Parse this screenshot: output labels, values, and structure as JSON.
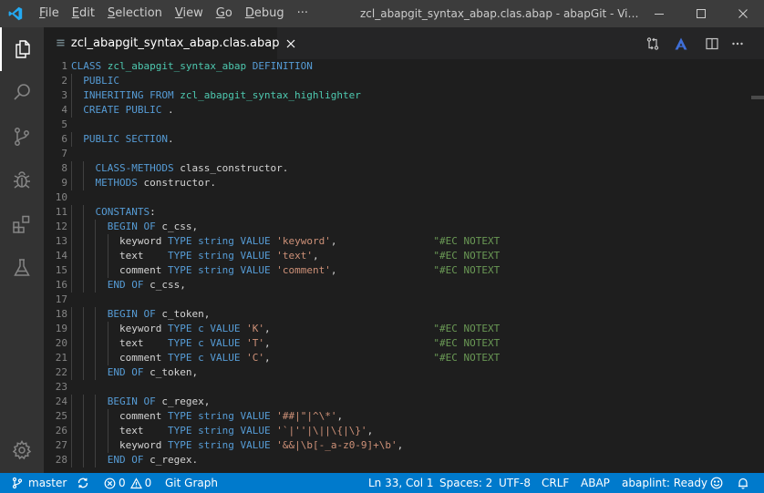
{
  "titlebar": {
    "menu": [
      "File",
      "Edit",
      "Selection",
      "View",
      "Go",
      "Debug",
      "···"
    ],
    "menu_accel": [
      0,
      0,
      0,
      0,
      0,
      0,
      -1
    ],
    "title": "zcl_abapgit_syntax_abap.clas.abap - abapGit - Visual Studio Code"
  },
  "tab": {
    "label": "zcl_abapgit_syntax_abap.clas.abap"
  },
  "editor": {
    "line_numbers": [
      "1",
      "2",
      "3",
      "4",
      "5",
      "6",
      "7",
      "8",
      "9",
      "10",
      "11",
      "12",
      "13",
      "14",
      "15",
      "16",
      "17",
      "18",
      "19",
      "20",
      "21",
      "22",
      "23",
      "24",
      "25",
      "26",
      "27",
      "28"
    ],
    "lines": [
      [
        [
          "kw",
          "CLASS "
        ],
        [
          "cls",
          "zcl_abapgit_syntax_abap"
        ],
        [
          "kw",
          " DEFINITION"
        ]
      ],
      [
        [
          "p",
          "  "
        ],
        [
          "kw",
          "PUBLIC"
        ]
      ],
      [
        [
          "p",
          "  "
        ],
        [
          "kw",
          "INHERITING FROM "
        ],
        [
          "cls",
          "zcl_abapgit_syntax_highlighter"
        ]
      ],
      [
        [
          "p",
          "  "
        ],
        [
          "kw",
          "CREATE PUBLIC"
        ],
        [
          "p",
          " ."
        ]
      ],
      [],
      [
        [
          "p",
          "  "
        ],
        [
          "kw",
          "PUBLIC SECTION"
        ],
        [
          "p",
          "."
        ]
      ],
      [],
      [
        [
          "p",
          "    "
        ],
        [
          "kw",
          "CLASS-METHODS"
        ],
        [
          "p",
          " class_constructor."
        ]
      ],
      [
        [
          "p",
          "    "
        ],
        [
          "kw",
          "METHODS"
        ],
        [
          "p",
          " constructor."
        ]
      ],
      [],
      [
        [
          "p",
          "    "
        ],
        [
          "kw",
          "CONSTANTS"
        ],
        [
          "p",
          ":"
        ]
      ],
      [
        [
          "p",
          "      "
        ],
        [
          "kw",
          "BEGIN OF"
        ],
        [
          "p",
          " c_css,"
        ]
      ],
      [
        [
          "p",
          "        keyword "
        ],
        [
          "kw",
          "TYPE"
        ],
        [
          "p",
          " "
        ],
        [
          "kw",
          "string"
        ],
        [
          "p",
          " "
        ],
        [
          "kw",
          "VALUE"
        ],
        [
          "p",
          " "
        ],
        [
          "str",
          "'keyword'"
        ],
        [
          "p",
          ",                "
        ],
        [
          "cmt",
          "\"#EC NOTEXT"
        ]
      ],
      [
        [
          "p",
          "        text    "
        ],
        [
          "kw",
          "TYPE"
        ],
        [
          "p",
          " "
        ],
        [
          "kw",
          "string"
        ],
        [
          "p",
          " "
        ],
        [
          "kw",
          "VALUE"
        ],
        [
          "p",
          " "
        ],
        [
          "str",
          "'text'"
        ],
        [
          "p",
          ",                   "
        ],
        [
          "cmt",
          "\"#EC NOTEXT"
        ]
      ],
      [
        [
          "p",
          "        comment "
        ],
        [
          "kw",
          "TYPE"
        ],
        [
          "p",
          " "
        ],
        [
          "kw",
          "string"
        ],
        [
          "p",
          " "
        ],
        [
          "kw",
          "VALUE"
        ],
        [
          "p",
          " "
        ],
        [
          "str",
          "'comment'"
        ],
        [
          "p",
          ",                "
        ],
        [
          "cmt",
          "\"#EC NOTEXT"
        ]
      ],
      [
        [
          "p",
          "      "
        ],
        [
          "kw",
          "END OF"
        ],
        [
          "p",
          " c_css,"
        ]
      ],
      [],
      [
        [
          "p",
          "      "
        ],
        [
          "kw",
          "BEGIN OF"
        ],
        [
          "p",
          " c_token,"
        ]
      ],
      [
        [
          "p",
          "        keyword "
        ],
        [
          "kw",
          "TYPE"
        ],
        [
          "p",
          " "
        ],
        [
          "kw",
          "c"
        ],
        [
          "p",
          " "
        ],
        [
          "kw",
          "VALUE"
        ],
        [
          "p",
          " "
        ],
        [
          "str",
          "'K'"
        ],
        [
          "p",
          ",                           "
        ],
        [
          "cmt",
          "\"#EC NOTEXT"
        ]
      ],
      [
        [
          "p",
          "        text    "
        ],
        [
          "kw",
          "TYPE"
        ],
        [
          "p",
          " "
        ],
        [
          "kw",
          "c"
        ],
        [
          "p",
          " "
        ],
        [
          "kw",
          "VALUE"
        ],
        [
          "p",
          " "
        ],
        [
          "str",
          "'T'"
        ],
        [
          "p",
          ",                           "
        ],
        [
          "cmt",
          "\"#EC NOTEXT"
        ]
      ],
      [
        [
          "p",
          "        comment "
        ],
        [
          "kw",
          "TYPE"
        ],
        [
          "p",
          " "
        ],
        [
          "kw",
          "c"
        ],
        [
          "p",
          " "
        ],
        [
          "kw",
          "VALUE"
        ],
        [
          "p",
          " "
        ],
        [
          "str",
          "'C'"
        ],
        [
          "p",
          ",                           "
        ],
        [
          "cmt",
          "\"#EC NOTEXT"
        ]
      ],
      [
        [
          "p",
          "      "
        ],
        [
          "kw",
          "END OF"
        ],
        [
          "p",
          " c_token,"
        ]
      ],
      [],
      [
        [
          "p",
          "      "
        ],
        [
          "kw",
          "BEGIN OF"
        ],
        [
          "p",
          " c_regex,"
        ]
      ],
      [
        [
          "p",
          "        comment "
        ],
        [
          "kw",
          "TYPE"
        ],
        [
          "p",
          " "
        ],
        [
          "kw",
          "string"
        ],
        [
          "p",
          " "
        ],
        [
          "kw",
          "VALUE"
        ],
        [
          "p",
          " "
        ],
        [
          "str",
          "'##|\"|^\\*'"
        ],
        [
          "p",
          ","
        ]
      ],
      [
        [
          "p",
          "        text    "
        ],
        [
          "kw",
          "TYPE"
        ],
        [
          "p",
          " "
        ],
        [
          "kw",
          "string"
        ],
        [
          "p",
          " "
        ],
        [
          "kw",
          "VALUE"
        ],
        [
          "p",
          " "
        ],
        [
          "str",
          "'`|''|\\||\\{|\\}'"
        ],
        [
          "p",
          ","
        ]
      ],
      [
        [
          "p",
          "        keyword "
        ],
        [
          "kw",
          "TYPE"
        ],
        [
          "p",
          " "
        ],
        [
          "kw",
          "string"
        ],
        [
          "p",
          " "
        ],
        [
          "kw",
          "VALUE"
        ],
        [
          "p",
          " "
        ],
        [
          "str",
          "'&&|\\b[-_a-z0-9]+\\b'"
        ],
        [
          "p",
          ","
        ]
      ],
      [
        [
          "p",
          "      "
        ],
        [
          "kw",
          "END OF"
        ],
        [
          "p",
          " c_regex."
        ]
      ]
    ]
  },
  "statusbar": {
    "branch": "master",
    "errors": "0",
    "warnings": "0",
    "git_graph": "Git Graph",
    "position": "Ln 33, Col 1",
    "spaces": "Spaces: 2",
    "encoding": "UTF-8",
    "eol": "CRLF",
    "language": "ABAP",
    "linter": "abaplint: Ready"
  },
  "icons": {
    "activity": [
      "files-icon",
      "search-icon",
      "source-control-icon",
      "debug-icon",
      "extensions-icon",
      "testing-icon",
      "settings-gear-icon"
    ],
    "editor_actions": [
      "git-compare-icon",
      "abaplint-icon",
      "split-editor-icon",
      "more-actions-icon"
    ]
  },
  "colors": {
    "keyword": "#569cd6",
    "class": "#4ec9b0",
    "string": "#ce9178",
    "comment": "#6a9955",
    "statusbar": "#007acc",
    "titlebar": "#3c3c3c",
    "activitybar": "#333333",
    "editor_bg": "#1e1e1e"
  }
}
